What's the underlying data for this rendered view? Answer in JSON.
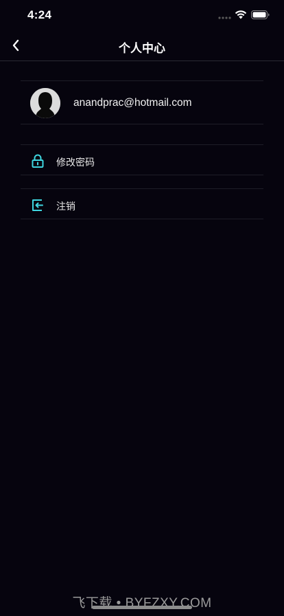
{
  "status_bar": {
    "time": "4:24"
  },
  "nav": {
    "title": "个人中心",
    "back_icon": "chevron-left-icon"
  },
  "profile": {
    "email": "anandprac@hotmail.com",
    "avatar_icon": "user-silhouette-icon"
  },
  "menu": {
    "items": [
      {
        "label": "修改密码",
        "icon": "lock-icon"
      },
      {
        "label": "注销",
        "icon": "logout-icon"
      }
    ]
  },
  "colors": {
    "background": "#06040e",
    "accent": "#3fd6e0",
    "divider": "#1f1e28"
  },
  "watermark": "飞下载 • BYFZXY.COM"
}
